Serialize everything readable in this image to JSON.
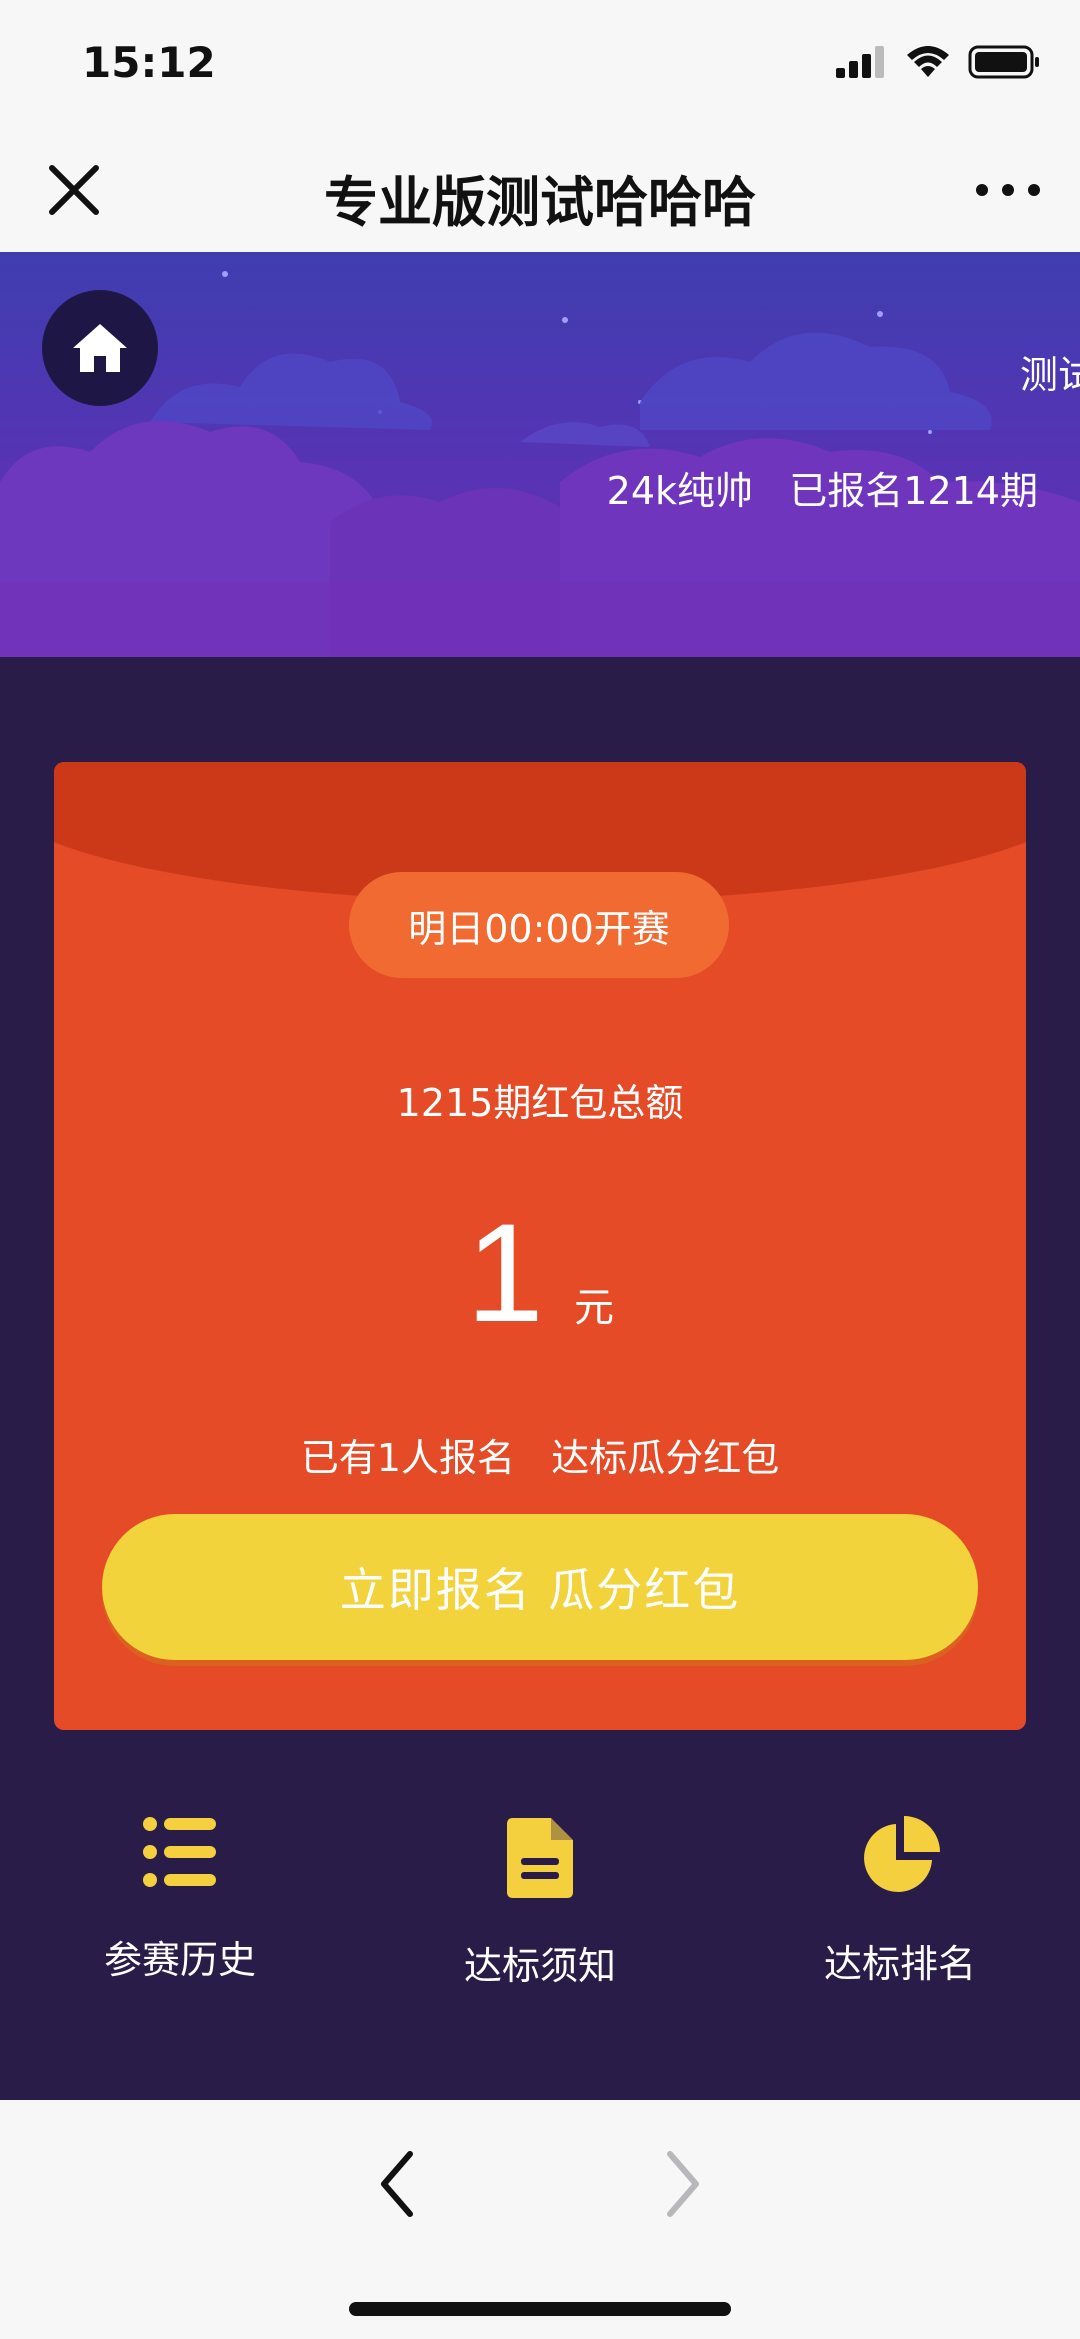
{
  "status_bar": {
    "time": "15:12"
  },
  "nav": {
    "title": "专业版测试哈哈哈"
  },
  "banner": {
    "marquee_text": "测试",
    "user_name": "24k纯帅",
    "registered_label": "已报名1214期"
  },
  "card": {
    "start_label": "明日00:00开赛",
    "total_label": "1215期红包总额",
    "amount": "1",
    "amount_unit": "元",
    "signup_info": "已有1人报名   达标瓜分红包",
    "signup_button": "立即报名 瓜分红包"
  },
  "menu": {
    "items": [
      {
        "label": "参赛历史",
        "icon": "list-icon"
      },
      {
        "label": "达标须知",
        "icon": "document-icon"
      },
      {
        "label": "达标排名",
        "icon": "pie-chart-icon"
      }
    ]
  },
  "colors": {
    "accent_red": "#e64b27",
    "accent_yellow": "#f2d33b",
    "background_dark": "#2a1c48",
    "banner_purple": "#5335b3"
  }
}
